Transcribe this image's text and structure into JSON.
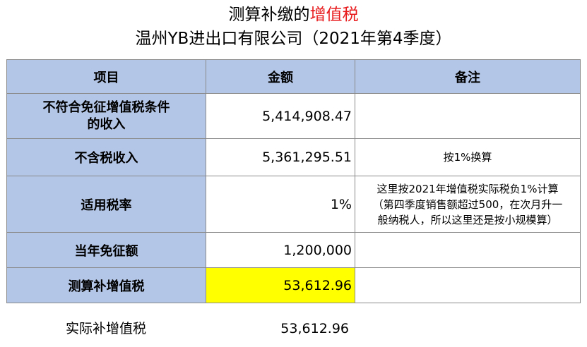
{
  "title": {
    "line1_prefix": "测算补缴的",
    "line1_highlight": "增值税",
    "line2": "温州YB进出口有限公司（2021年第4季度）"
  },
  "colors": {
    "header_fill": "#b4c6e7",
    "highlight_fill": "#ffff00",
    "title_highlight": "#e8191b"
  },
  "table": {
    "headers": [
      "项目",
      "金额",
      "备注"
    ],
    "rows": [
      {
        "label": "不符合免征增值税条件的收入",
        "amount": "5,414,908.47",
        "note": ""
      },
      {
        "label": "不含税收入",
        "amount": "5,361,295.51",
        "note": "按1%换算"
      },
      {
        "label": "适用税率",
        "amount": "1%",
        "note": "这里按2021年增值税实际税负1%计算（第四季度销售额超过500，在次月升一般纳税人，所以这里还是按小规模算）"
      },
      {
        "label": "当年免征额",
        "amount": "1,200,000",
        "note": ""
      },
      {
        "label": "测算补增值税",
        "amount": "53,612.96",
        "note": ""
      }
    ]
  },
  "footer": {
    "label": "实际补增值税",
    "amount": "53,612.96"
  }
}
